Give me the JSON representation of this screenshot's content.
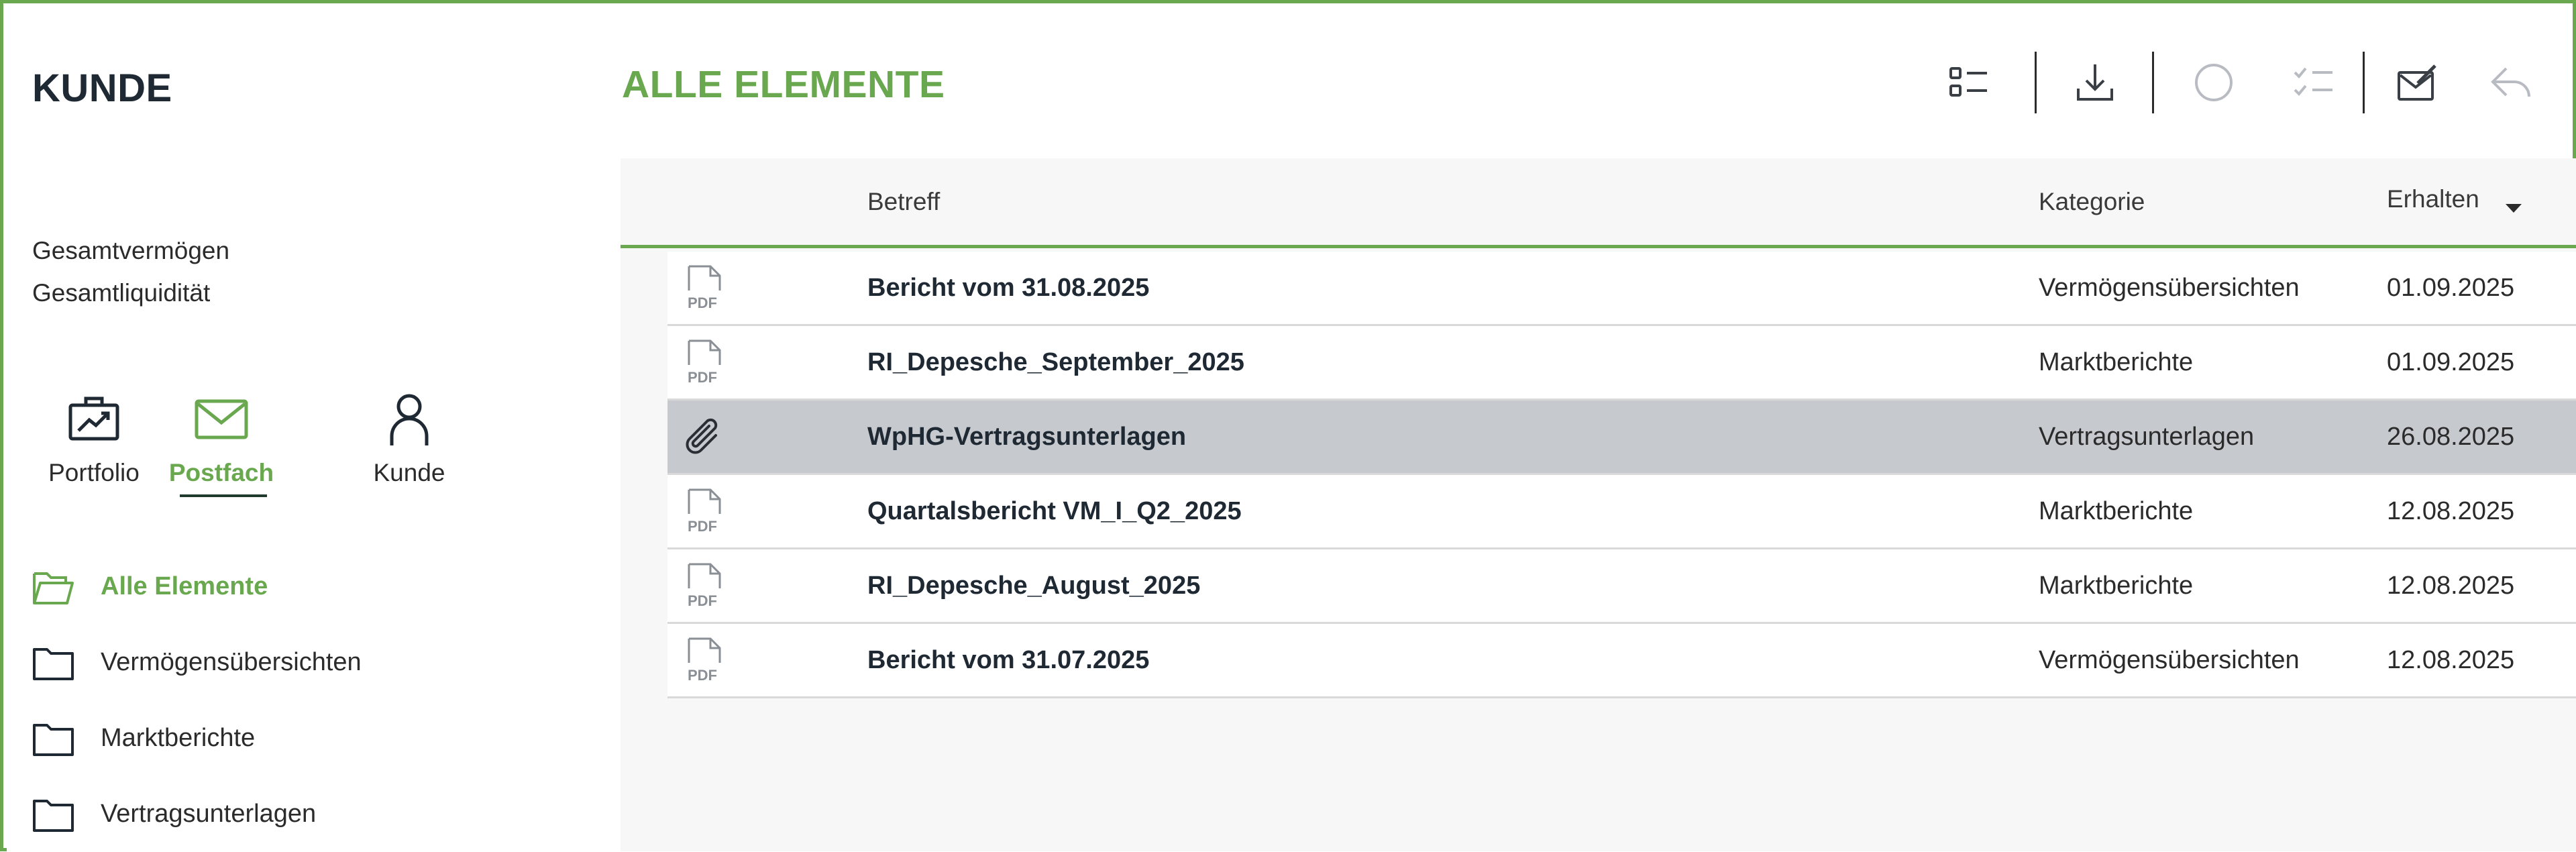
{
  "sidebar": {
    "brand": "KUNDE",
    "metrics": [
      {
        "label": "Gesamtvermögen"
      },
      {
        "label": "Gesamtliquidität"
      }
    ],
    "nav": [
      {
        "label": "Portfolio",
        "icon": "briefcase-chart-icon",
        "active": false
      },
      {
        "label": "Postfach",
        "icon": "envelope-icon",
        "active": true
      },
      {
        "label": "Kunde",
        "icon": "user-icon",
        "active": false
      }
    ],
    "folders": [
      {
        "label": "Alle Elemente",
        "icon": "folder-open-icon",
        "active": true
      },
      {
        "label": "Vermögensübersichten",
        "icon": "folder-icon",
        "active": false
      },
      {
        "label": "Marktberichte",
        "icon": "folder-icon",
        "active": false
      },
      {
        "label": "Vertragsunterlagen",
        "icon": "folder-icon",
        "active": false
      }
    ]
  },
  "header": {
    "title": "ALLE ELEMENTE",
    "toolbar": [
      {
        "name": "list-view-icon"
      },
      {
        "name": "download-icon"
      },
      {
        "name": "circle-select-icon",
        "disabled": true
      },
      {
        "name": "checklist-icon",
        "disabled": true
      },
      {
        "name": "compose-icon"
      },
      {
        "name": "reply-icon",
        "disabled": true
      }
    ]
  },
  "table": {
    "columns": {
      "betreff": "Betreff",
      "kategorie": "Kategorie",
      "erhalten": "Erhalten"
    },
    "sort": {
      "column": "erhalten",
      "direction": "desc"
    },
    "rows": [
      {
        "icon": "pdf-icon",
        "betreff": "Bericht vom 31.08.2025",
        "kategorie": "Vermögensübersichten",
        "erhalten": "01.09.2025",
        "selected": false
      },
      {
        "icon": "pdf-icon",
        "betreff": "RI_Depesche_September_2025",
        "kategorie": "Marktberichte",
        "erhalten": "01.09.2025",
        "selected": false
      },
      {
        "icon": "paperclip-icon",
        "betreff": "WpHG-Vertragsunterlagen",
        "kategorie": "Vertragsunterlagen",
        "erhalten": "26.08.2025",
        "selected": true
      },
      {
        "icon": "pdf-icon",
        "betreff": "Quartalsbericht VM_I_Q2_2025",
        "kategorie": "Marktberichte",
        "erhalten": "12.08.2025",
        "selected": false
      },
      {
        "icon": "pdf-icon",
        "betreff": "RI_Depesche_August_2025",
        "kategorie": "Marktberichte",
        "erhalten": "12.08.2025",
        "selected": false
      },
      {
        "icon": "pdf-icon",
        "betreff": "Bericht vom 31.07.2025",
        "kategorie": "Vermögensübersichten",
        "erhalten": "12.08.2025",
        "selected": false
      }
    ]
  },
  "colors": {
    "accent": "#6aa84f",
    "text": "#1f2933",
    "selected_row": "#c6c9ce",
    "table_bg": "#f7f7f7",
    "disabled_icon": "#b8bcc2"
  }
}
